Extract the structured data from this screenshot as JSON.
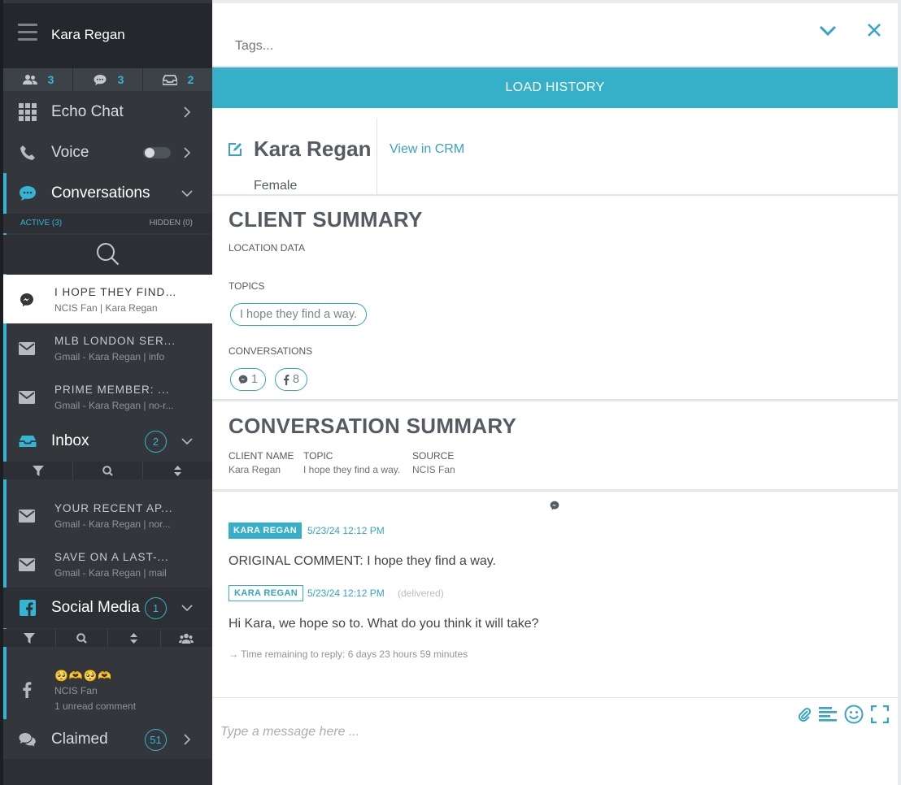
{
  "sidebar": {
    "username": "Kara Regan",
    "counts": [
      {
        "icon": "users-icon",
        "value": "3"
      },
      {
        "icon": "chat-bubble-icon",
        "value": "3"
      },
      {
        "icon": "inbox-icon",
        "value": "2"
      }
    ],
    "nav": {
      "echo_chat": "Echo Chat",
      "voice": "Voice",
      "conversations": "Conversations",
      "inbox": "Inbox",
      "inbox_badge": "2",
      "social_media": "Social Media",
      "social_badge": "1",
      "claimed": "Claimed",
      "claimed_badge": "51"
    },
    "conv_tabs": {
      "active": "ACTIVE (3)",
      "hidden": "HIDDEN (0)"
    },
    "conversations": [
      {
        "title": "I HOPE THEY FIND...",
        "sub": "NCIS Fan | Kara Regan",
        "icon": "messenger-icon"
      },
      {
        "title": "MLB LONDON SER...",
        "sub": "Gmail - Kara Regan | info",
        "icon": "envelope-icon"
      },
      {
        "title": "PRIME MEMBER: ...",
        "sub": "Gmail - Kara Regan | no-r...",
        "icon": "envelope-icon"
      }
    ],
    "inbox_items": [
      {
        "title": "YOUR RECENT AP...",
        "sub": "Gmail - Kara Regan | nor...",
        "icon": "envelope-icon"
      },
      {
        "title": "SAVE ON A LAST-...",
        "sub": "Gmail - Kara Regan | mail",
        "icon": "envelope-icon"
      }
    ],
    "social_items": [
      {
        "title": "🥺🫶🥺🫶",
        "sub": "NCIS Fan",
        "sub2": "1 unread comment",
        "icon": "facebook-icon"
      }
    ]
  },
  "main": {
    "tags_placeholder": "Tags...",
    "load_history": "LOAD HISTORY",
    "profile": {
      "name": "Kara Regan",
      "gender": "Female",
      "crm_link": "View in CRM"
    },
    "client_summary": {
      "title": "CLIENT SUMMARY",
      "location_label": "LOCATION DATA",
      "topics_label": "TOPICS",
      "topics": [
        "I hope they find a way."
      ],
      "conversations_label": "CONVERSATIONS",
      "conversation_counts": [
        {
          "icon": "messenger-icon",
          "count": "1"
        },
        {
          "icon": "facebook-icon",
          "count": "8"
        }
      ]
    },
    "conversation_summary": {
      "title": "CONVERSATION SUMMARY",
      "client_name_label": "CLIENT NAME",
      "client_name": "Kara Regan",
      "topic_label": "TOPIC",
      "topic": "I hope they find a way.",
      "source_label": "SOURCE",
      "source": "NCIS Fan"
    },
    "messages": [
      {
        "author": "KARA REGAN",
        "time": "5/23/24 12:12 PM",
        "status": "",
        "body": "ORIGINAL COMMENT: I hope they find a way."
      },
      {
        "author": "KARA REGAN",
        "time": "5/23/24 12:12 PM",
        "status": "(delivered)",
        "body": "Hi Kara, we hope so to. What do you think it will take?"
      }
    ],
    "time_remaining": "→ Time remaining to reply: 6 days 23 hours 59 minutes",
    "composer_placeholder": "Type a message here ..."
  },
  "colors": {
    "accent": "#36b0c9",
    "sidebar": "#33373c",
    "text": "#545b62"
  }
}
